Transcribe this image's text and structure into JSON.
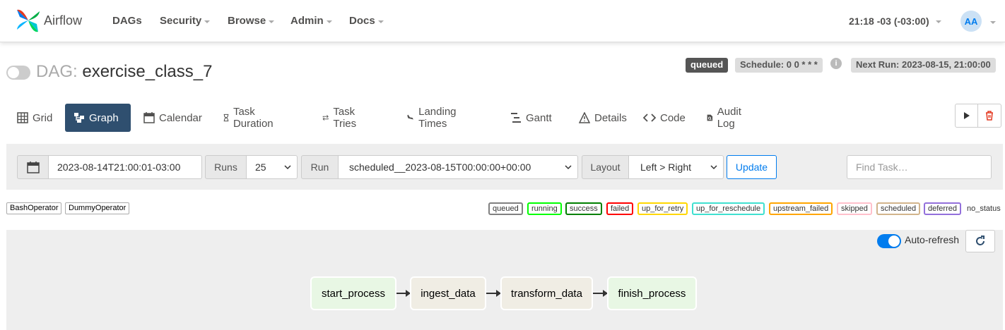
{
  "navbar": {
    "brand": "Airflow",
    "items": [
      "DAGs",
      "Security",
      "Browse",
      "Admin",
      "Docs"
    ],
    "time": "21:18 -03 (-03:00)",
    "avatar": "AA"
  },
  "dag": {
    "prefix": "DAG:",
    "name": "exercise_class_7",
    "state": "queued",
    "schedule": "Schedule: 0 0 * * *",
    "next_run": "Next Run: 2023-08-15, 21:00:00",
    "info_icon": "i"
  },
  "tabs": [
    "Grid",
    "Graph",
    "Calendar",
    "Task Duration",
    "Task Tries",
    "Landing Times",
    "Gantt",
    "Details",
    "Code",
    "Audit Log"
  ],
  "active_tab": "Graph",
  "filters": {
    "date": "2023-08-14T21:00:01-03:00",
    "runs_label": "Runs",
    "runs_value": "25",
    "run_label": "Run",
    "run_value": "scheduled__2023-08-15T00:00:00+00:00",
    "layout_label": "Layout",
    "layout_value": "Left > Right",
    "update": "Update",
    "find_placeholder": "Find Task…"
  },
  "operators": [
    {
      "label": "BashOperator",
      "color": "#f0ede4"
    },
    {
      "label": "DummyOperator",
      "color": "#e8f7e4"
    }
  ],
  "statuses": [
    {
      "label": "queued",
      "color": "#808080"
    },
    {
      "label": "running",
      "color": "#00ff00"
    },
    {
      "label": "success",
      "color": "#008000"
    },
    {
      "label": "failed",
      "color": "#ff0000"
    },
    {
      "label": "up_for_retry",
      "color": "#ffd700"
    },
    {
      "label": "up_for_reschedule",
      "color": "#40e0d0"
    },
    {
      "label": "upstream_failed",
      "color": "#ffa500"
    },
    {
      "label": "skipped",
      "color": "#ffc0cb"
    },
    {
      "label": "scheduled",
      "color": "#d2b48c"
    },
    {
      "label": "deferred",
      "color": "#9370db"
    },
    {
      "label": "no_status",
      "color": ""
    }
  ],
  "graph": {
    "auto_refresh": "Auto-refresh",
    "nodes": [
      "start_process",
      "ingest_data",
      "transform_data",
      "finish_process"
    ]
  }
}
